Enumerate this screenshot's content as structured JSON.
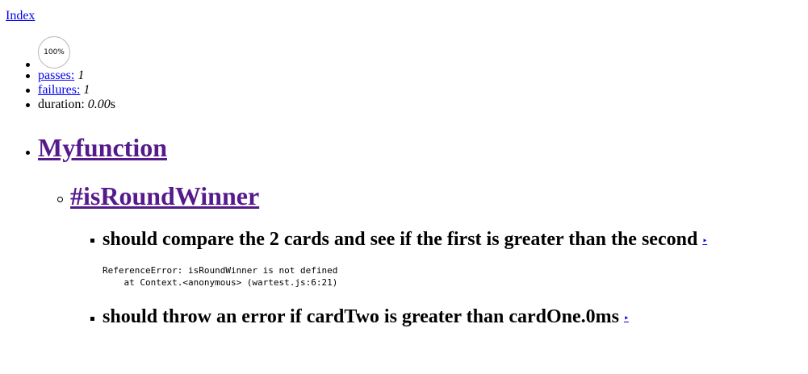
{
  "nav": {
    "index_label": "Index"
  },
  "stats": {
    "progress_text": "100%",
    "passes_label": "passes:",
    "passes_value": "1",
    "failures_label": "failures:",
    "failures_value": "1",
    "duration_label": "duration:",
    "duration_value": "0.00",
    "duration_unit": "s"
  },
  "report": {
    "suite_title": "Myfunction",
    "sub_suite_title": "#isRoundWinner",
    "tests": [
      {
        "title": "should compare the 2 cards and see if the first is greater than the second",
        "replay": "‣"
      },
      {
        "title": "should throw an error if cardTwo is greater than cardOne.0ms",
        "replay": "‣"
      }
    ],
    "error_line_1": "ReferenceError: isRoundWinner is not defined",
    "error_line_2": "    at Context.<anonymous> (wartest.js:6:21)"
  }
}
